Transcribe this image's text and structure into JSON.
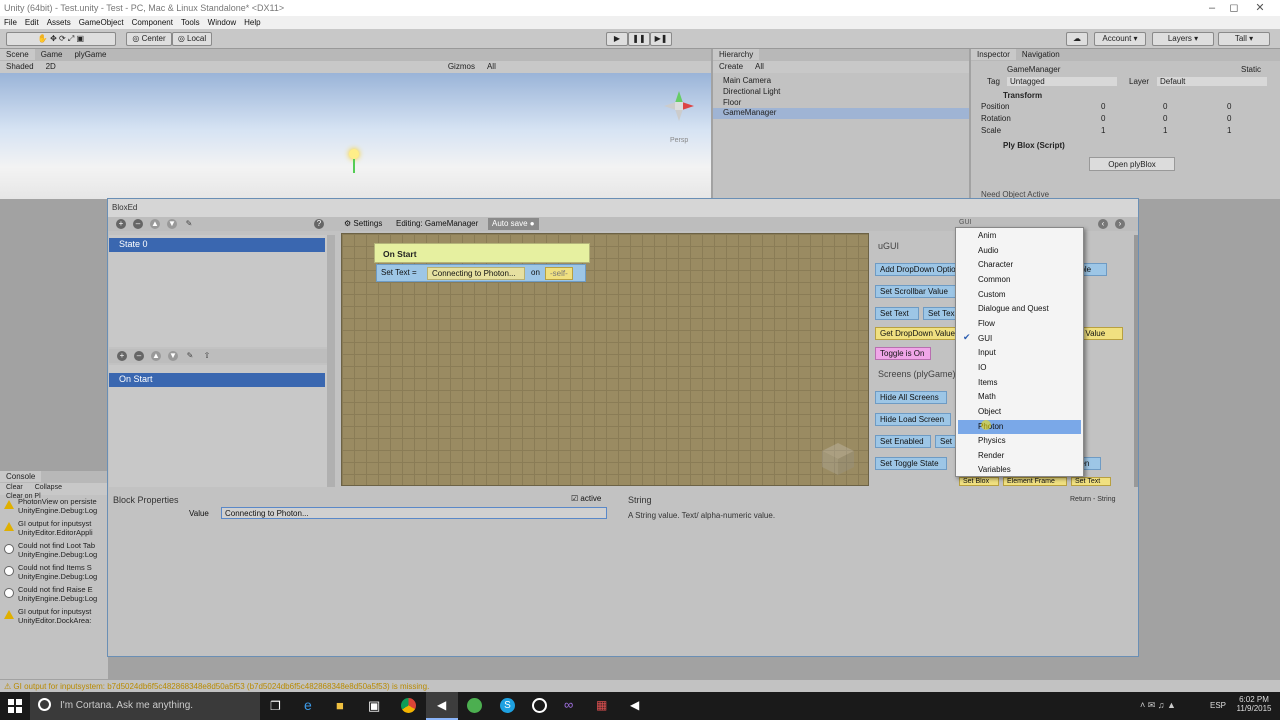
{
  "window": {
    "title": "Unity (64bit) - Test.unity - Test - PC, Mac & Linux Standalone* <DX11>"
  },
  "menu": [
    "File",
    "Edit",
    "Assets",
    "GameObject",
    "Component",
    "Tools",
    "Window",
    "Help"
  ],
  "toolbar": {
    "pivot": "Center",
    "space": "Local",
    "account": "Account",
    "layers": "Layers",
    "layout": "Tall"
  },
  "scene": {
    "tabs": [
      "Scene",
      "Game",
      "plyGame"
    ],
    "shaded": "Shaded",
    "mode_2d": "2D",
    "gizmos": "Gizmos",
    "search": "All",
    "persp": "Persp"
  },
  "hierarchy": {
    "tab": "Hierarchy",
    "create": "Create",
    "search": "All",
    "items": [
      "Main Camera",
      "Directional Light",
      "Floor",
      "GameManager"
    ]
  },
  "inspector": {
    "tabs": [
      "Inspector",
      "Navigation"
    ],
    "object_name": "GameManager",
    "static": "Static",
    "tag_label": "Tag",
    "tag_value": "Untagged",
    "layer_label": "Layer",
    "layer_value": "Default",
    "transform": "Transform",
    "rows": [
      {
        "label": "Position",
        "x": "0",
        "y": "0",
        "z": "0"
      },
      {
        "label": "Rotation",
        "x": "0",
        "y": "0",
        "z": "0"
      },
      {
        "label": "Scale",
        "x": "1",
        "y": "1",
        "z": "1"
      }
    ],
    "script": "Ply Blox (Script)",
    "open_button": "Open plyBlox",
    "need_active": "Need Object Active"
  },
  "blox": {
    "title": "BloxEd",
    "settings": "Settings",
    "editing": "Editing: GameManager",
    "autosave": "Auto save",
    "state": "State 0",
    "event": "On Start",
    "block_header": "On Start",
    "set_text": "Set Text =",
    "connecting": "Connecting to Photon...",
    "on": "on",
    "self": "-self-"
  },
  "palette": {
    "group_label": "GUI",
    "section_ugui": "uGUI",
    "section_screens": "Screens (plyGame)",
    "buttons": [
      "Add DropDown Optio",
      "Set Scrollbar Value",
      "Set Text",
      "Set Tex",
      "Get DropDown Value",
      "Toggle is On",
      "Hide All Screens",
      "Hide Load Screen",
      "Set Enabled",
      "Set",
      "Set Toggle State",
      "able",
      "er Value",
      "een",
      "Set Blox",
      "Element Frame",
      "Set Text"
    ],
    "side_label": "ment"
  },
  "dropdown": {
    "items": [
      "Anim",
      "Audio",
      "Character",
      "Common",
      "Custom",
      "Dialogue and Quest",
      "Flow",
      "GUI",
      "Input",
      "IO",
      "Items",
      "Math",
      "Object",
      "Photon",
      "Physics",
      "Render",
      "Variables"
    ],
    "checked": "GUI",
    "highlighted": "Photon"
  },
  "properties": {
    "title": "Block Properties",
    "active": "active",
    "value_label": "Value",
    "value": "Connecting to Photon..."
  },
  "help": {
    "title": "String",
    "returns": "Return - String",
    "text": "A String value. Text/ alpha-numeric value."
  },
  "console": {
    "tab": "Console",
    "buttons": [
      "Clear",
      "Collapse",
      "Clear on Pl"
    ],
    "messages": [
      {
        "type": "warn",
        "l1": "PhotonView on persiste",
        "l2": "UnityEngine.Debug:Log"
      },
      {
        "type": "warn",
        "l1": "GI output for inputsyst",
        "l2": "UnityEditor.EditorAppli"
      },
      {
        "type": "err",
        "l1": "Could not find Loot Tab",
        "l2": "UnityEngine.Debug:Log"
      },
      {
        "type": "err",
        "l1": "Could not find Items S",
        "l2": "UnityEngine.Debug:Log"
      },
      {
        "type": "err",
        "l1": "Could not find Raise E",
        "l2": "UnityEngine.Debug:Log"
      },
      {
        "type": "warn",
        "l1": "GI output for inputsyst",
        "l2": "UnityEditor.DockArea:"
      }
    ]
  },
  "status": "GI output for inputsystem: b7d5024db6f5c482868348e8d50a5f53 (b7d5024db6f5c482868348e8d50a5f53) is missing.",
  "taskbar": {
    "cortana": "I'm Cortana. Ask me anything.",
    "lang": "ESP",
    "time": "6:02 PM",
    "date": "11/9/2015"
  }
}
